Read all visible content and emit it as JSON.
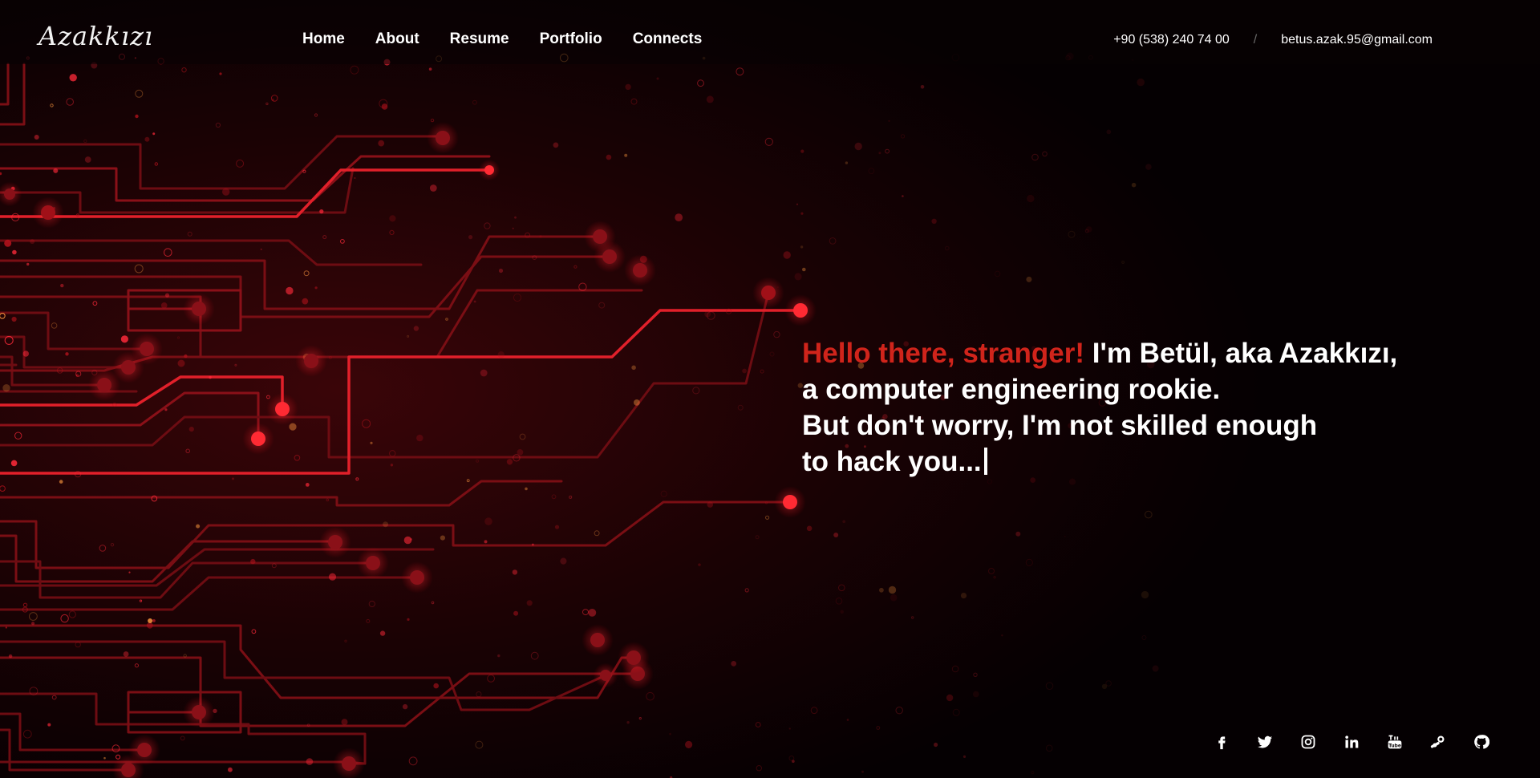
{
  "header": {
    "logo": "Azakkızı",
    "nav": [
      "Home",
      "About",
      "Resume",
      "Portfolio",
      "Connects"
    ],
    "phone": "+90 (538) 240 74 00",
    "separator": "/",
    "email": "betus.azak.95@gmail.com"
  },
  "hero": {
    "greeting": "Hello there, stranger!",
    "line1_rest": " I'm Betül, aka Azakkızı,",
    "line2": "a computer engineering rookie.",
    "line3": "But don't worry, I'm not skilled enough",
    "line4": "to hack you..."
  },
  "social": [
    "facebook-icon",
    "twitter-icon",
    "instagram-icon",
    "linkedin-icon",
    "youtube-icon",
    "steam-icon",
    "github-icon"
  ],
  "colors": {
    "accent": "#d0241b",
    "background": "#050002",
    "circuit": "#e0202a",
    "text": "#ffffff"
  }
}
